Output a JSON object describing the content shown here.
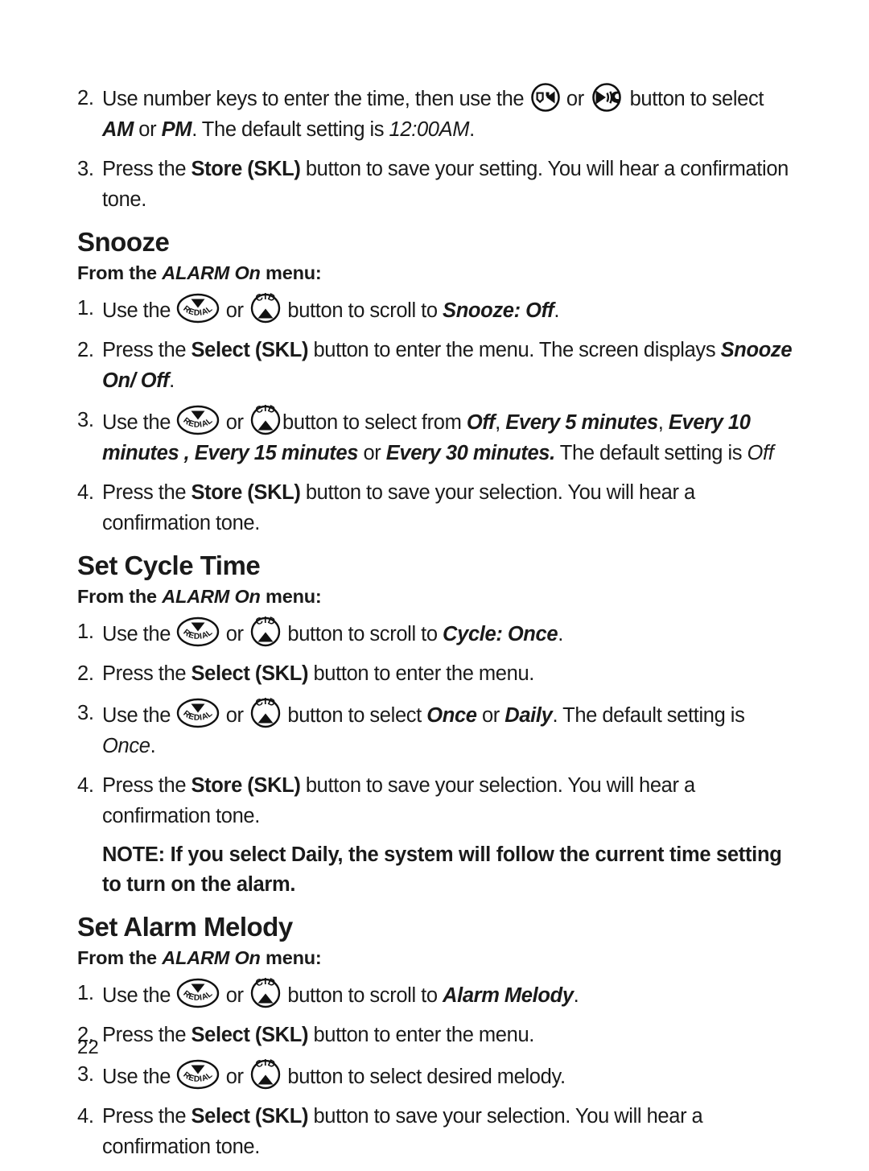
{
  "page": {
    "number": "22"
  },
  "icons": {
    "voicemail_left_button": "voicemail-left-button-icon",
    "speaker_right_button": "speaker-right-button-icon",
    "redial_button": "redial-button-icon",
    "cid_button": "cid-button-icon",
    "redial_label": "REDIAL",
    "cid_label": "CID"
  },
  "top_steps": [
    {
      "num": "2.",
      "parts": [
        {
          "t": "Use number keys to enter the time, then use the ",
          "s": "n"
        },
        {
          "t": "",
          "s": "icon-voicemail"
        },
        {
          "t": " or ",
          "s": "n"
        },
        {
          "t": "",
          "s": "icon-speaker"
        },
        {
          "t": " button to select ",
          "s": "n"
        },
        {
          "t": "AM",
          "s": "bi"
        },
        {
          "t": " or ",
          "s": "n"
        },
        {
          "t": "PM",
          "s": "bi"
        },
        {
          "t": ". The default setting is ",
          "s": "n"
        },
        {
          "t": "12:00AM",
          "s": "i"
        },
        {
          "t": ".",
          "s": "n"
        }
      ]
    },
    {
      "num": "3.",
      "parts": [
        {
          "t": "Press the ",
          "s": "n"
        },
        {
          "t": "Store (SKL)",
          "s": "b"
        },
        {
          "t": " button to save your setting. You will hear a confirmation tone.",
          "s": "n"
        }
      ]
    }
  ],
  "sections": [
    {
      "heading": "Snooze",
      "frommenu_prefix": "From the ",
      "frommenu_italic": "ALARM On",
      "frommenu_suffix": " menu:",
      "steps": [
        {
          "num": "1.",
          "parts": [
            {
              "t": "Use the ",
              "s": "n"
            },
            {
              "t": "",
              "s": "icon-redial"
            },
            {
              "t": " or ",
              "s": "n"
            },
            {
              "t": "",
              "s": "icon-cid"
            },
            {
              "t": " button to scroll to ",
              "s": "n"
            },
            {
              "t": "Snooze: Off",
              "s": "bi"
            },
            {
              "t": ".",
              "s": "n"
            }
          ]
        },
        {
          "num": "2.",
          "parts": [
            {
              "t": "Press the ",
              "s": "n"
            },
            {
              "t": "Select (SKL)",
              "s": "b"
            },
            {
              "t": " button to enter the menu. The screen displays ",
              "s": "n"
            },
            {
              "t": "Snooze On/ Off",
              "s": "bi"
            },
            {
              "t": ".",
              "s": "n"
            }
          ]
        },
        {
          "num": "3.",
          "parts": [
            {
              "t": "Use the ",
              "s": "n"
            },
            {
              "t": "",
              "s": "icon-redial"
            },
            {
              "t": " or ",
              "s": "n"
            },
            {
              "t": "",
              "s": "icon-cid"
            },
            {
              "t": "button to select from ",
              "s": "n"
            },
            {
              "t": "Off",
              "s": "bi"
            },
            {
              "t": ", ",
              "s": "n"
            },
            {
              "t": "Every 5 minutes",
              "s": "bi"
            },
            {
              "t": ", ",
              "s": "n"
            },
            {
              "t": "Every 10 minutes , Every 15 minutes",
              "s": "bi"
            },
            {
              "t": " or ",
              "s": "n"
            },
            {
              "t": "Every 30 minutes.",
              "s": "bi"
            },
            {
              "t": " The default setting is ",
              "s": "n"
            },
            {
              "t": "Off",
              "s": "i"
            }
          ]
        },
        {
          "num": "4.",
          "parts": [
            {
              "t": "Press the ",
              "s": "n"
            },
            {
              "t": "Store (SKL)",
              "s": "b"
            },
            {
              "t": " button to save your selection. You will hear a confirmation tone.",
              "s": "n"
            }
          ]
        }
      ],
      "note": null
    },
    {
      "heading": "Set Cycle Time",
      "frommenu_prefix": "From the ",
      "frommenu_italic": "ALARM On",
      "frommenu_suffix": " menu:",
      "steps": [
        {
          "num": "1.",
          "parts": [
            {
              "t": "Use the ",
              "s": "n"
            },
            {
              "t": "",
              "s": "icon-redial"
            },
            {
              "t": " or ",
              "s": "n"
            },
            {
              "t": "",
              "s": "icon-cid"
            },
            {
              "t": " button to scroll to ",
              "s": "n"
            },
            {
              "t": "Cycle: Once",
              "s": "bi"
            },
            {
              "t": ".",
              "s": "n"
            }
          ]
        },
        {
          "num": "2.",
          "parts": [
            {
              "t": "Press the ",
              "s": "n"
            },
            {
              "t": "Select (SKL)",
              "s": "b"
            },
            {
              "t": " button to enter the menu.",
              "s": "n"
            }
          ]
        },
        {
          "num": "3.",
          "parts": [
            {
              "t": "Use the ",
              "s": "n"
            },
            {
              "t": "",
              "s": "icon-redial"
            },
            {
              "t": " or ",
              "s": "n"
            },
            {
              "t": "",
              "s": "icon-cid"
            },
            {
              "t": " button to select ",
              "s": "n"
            },
            {
              "t": "Once",
              "s": "bi"
            },
            {
              "t": " or ",
              "s": "n"
            },
            {
              "t": "Daily",
              "s": "bi"
            },
            {
              "t": ". The default setting is ",
              "s": "n"
            },
            {
              "t": "Once",
              "s": "i"
            },
            {
              "t": ".",
              "s": "n"
            }
          ]
        },
        {
          "num": "4.",
          "parts": [
            {
              "t": "Press the ",
              "s": "n"
            },
            {
              "t": "Store (SKL)",
              "s": "b"
            },
            {
              "t": " button to save your selection. You will hear a confirmation tone.",
              "s": "n"
            }
          ]
        }
      ],
      "note": "NOTE: If you select Daily, the system will follow the current time setting to turn on the alarm."
    },
    {
      "heading": "Set Alarm Melody",
      "frommenu_prefix": "From the ",
      "frommenu_italic": "ALARM On",
      "frommenu_suffix": " menu:",
      "steps": [
        {
          "num": "1.",
          "parts": [
            {
              "t": "Use the ",
              "s": "n"
            },
            {
              "t": "",
              "s": "icon-redial"
            },
            {
              "t": " or ",
              "s": "n"
            },
            {
              "t": "",
              "s": "icon-cid"
            },
            {
              "t": " button to scroll to ",
              "s": "n"
            },
            {
              "t": "Alarm Melody",
              "s": "bi"
            },
            {
              "t": ".",
              "s": "n"
            }
          ]
        },
        {
          "num": "2.",
          "parts": [
            {
              "t": "Press the ",
              "s": "n"
            },
            {
              "t": "Select (SKL)",
              "s": "b"
            },
            {
              "t": " button to enter the menu.",
              "s": "n"
            }
          ]
        },
        {
          "num": "3.",
          "parts": [
            {
              "t": "Use the ",
              "s": "n"
            },
            {
              "t": "",
              "s": "icon-redial"
            },
            {
              "t": " or ",
              "s": "n"
            },
            {
              "t": "",
              "s": "icon-cid"
            },
            {
              "t": " button to select desired melody.",
              "s": "n"
            }
          ]
        },
        {
          "num": "4.",
          "parts": [
            {
              "t": "Press the ",
              "s": "n"
            },
            {
              "t": "Select (SKL)",
              "s": "b"
            },
            {
              "t": " button to save your selection. You will hear a confirmation tone.",
              "s": "n"
            }
          ]
        }
      ],
      "note": null
    }
  ]
}
